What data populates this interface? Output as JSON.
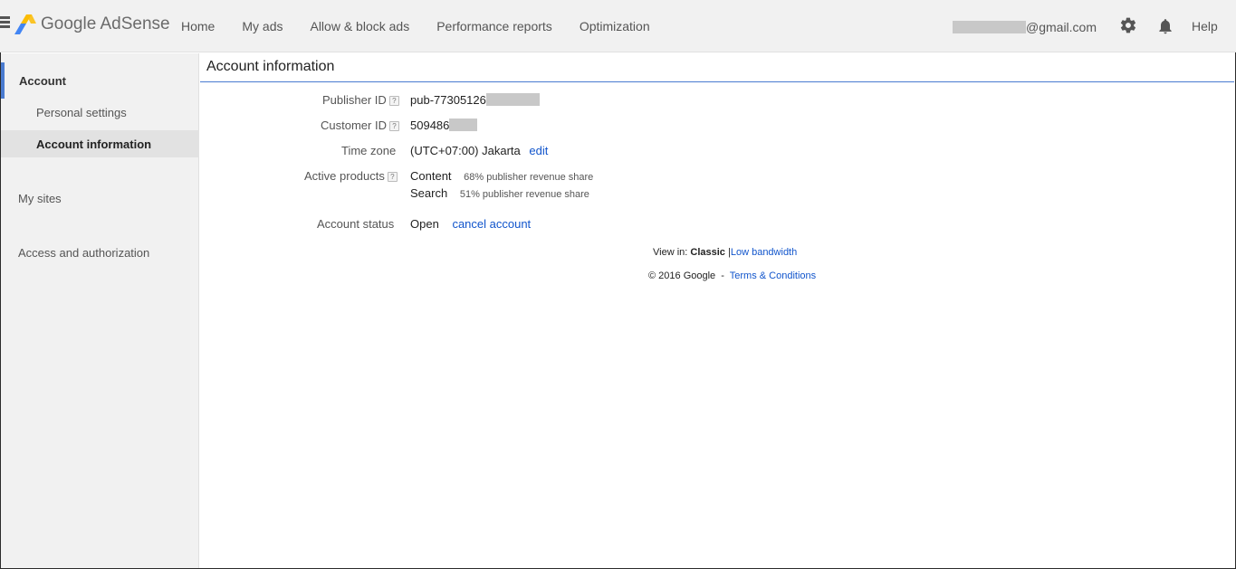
{
  "header": {
    "logo_text": "Google AdSense",
    "nav": [
      "Home",
      "My ads",
      "Allow & block ads",
      "Performance reports",
      "Optimization"
    ],
    "email_suffix": "@gmail.com",
    "help_label": "Help",
    "icons": [
      "menu-icon",
      "adsense-logo",
      "gear-icon",
      "bell-icon"
    ]
  },
  "sidebar": {
    "account_label": "Account",
    "items": [
      "Personal settings",
      "Account information",
      "My sites",
      "Access and authorization"
    ],
    "active_item": "Account information"
  },
  "main": {
    "title": "Account information",
    "rows": {
      "publisher_id": {
        "label": "Publisher ID",
        "value": "pub-77305126"
      },
      "customer_id": {
        "label": "Customer ID",
        "value": "509486"
      },
      "time_zone": {
        "label": "Time zone",
        "value": "(UTC+07:00) Jakarta",
        "action": "edit"
      },
      "active_products": {
        "label": "Active products",
        "products": [
          {
            "name": "Content",
            "share": "68% publisher revenue share"
          },
          {
            "name": "Search",
            "share": "51% publisher revenue share"
          }
        ]
      },
      "account_status": {
        "label": "Account status",
        "value": "Open",
        "action": "cancel account"
      }
    },
    "help_mark": "?"
  },
  "footer": {
    "view_in_label": "View in:",
    "classic": "Classic",
    "separator": "|",
    "low_bandwidth": "Low bandwidth",
    "copyright": "© 2016 Google",
    "dash": "-",
    "terms": "Terms & Conditions"
  },
  "colors": {
    "accent_blue": "#4a7bd0",
    "link_blue": "#1155cc",
    "topbar_bg": "#f1f1f1",
    "sidebar_active_bg": "#e2e2e2",
    "redaction_gray": "#c8c8c8",
    "logo_yellow": "#fbbc04",
    "logo_blue": "#4285f4"
  }
}
